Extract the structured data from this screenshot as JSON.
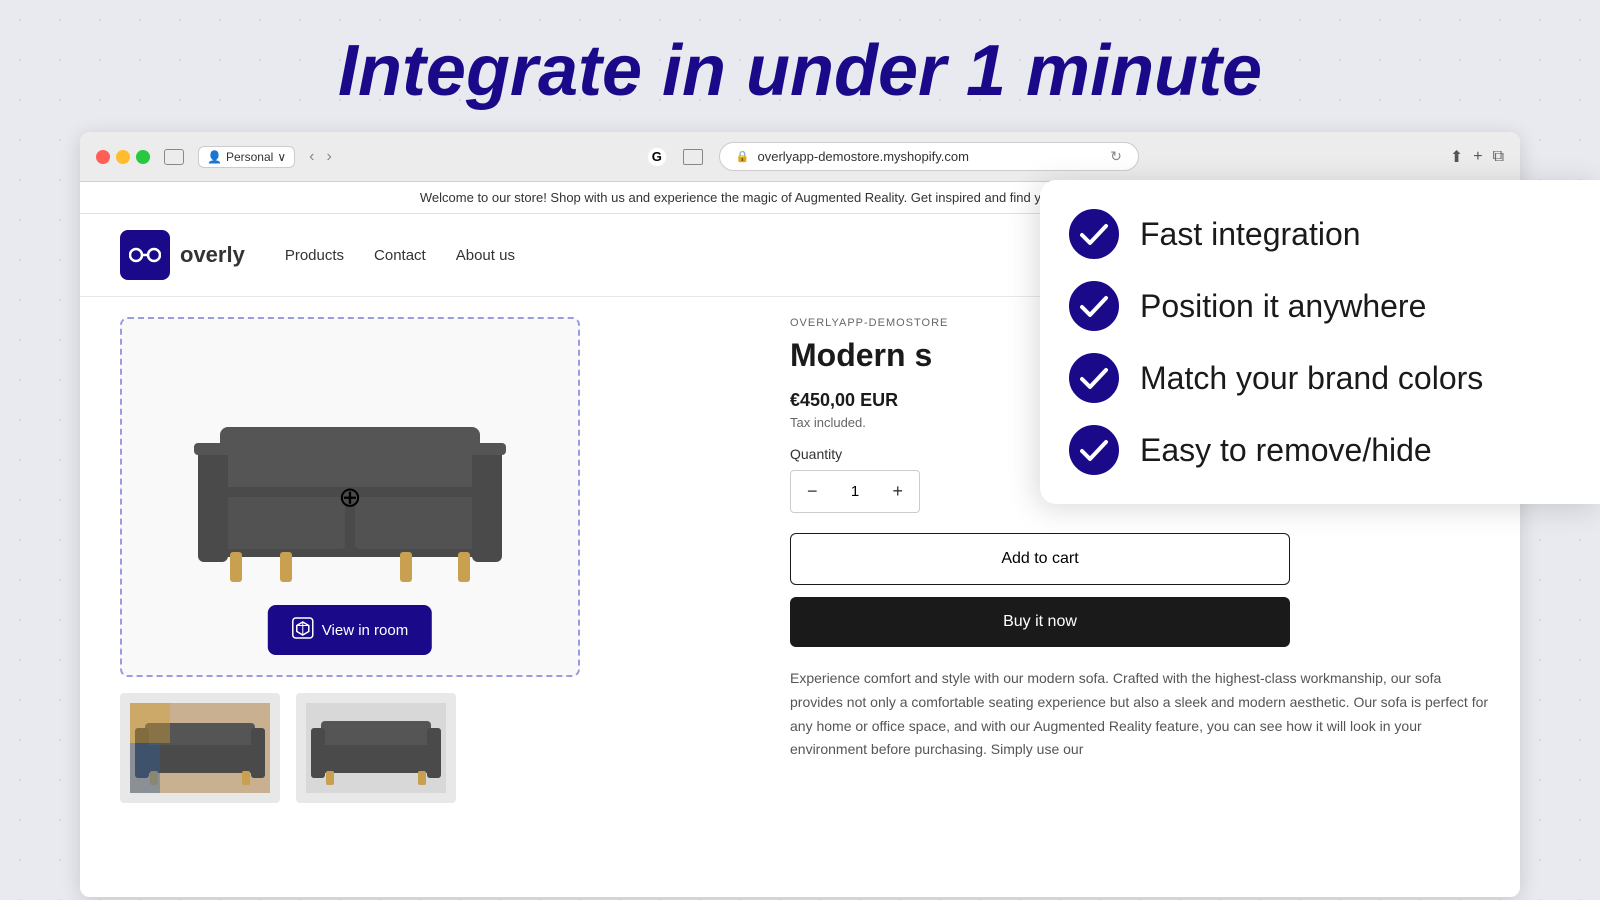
{
  "heading": {
    "title": "Integrate in under 1 minute"
  },
  "browser": {
    "profile": "Personal",
    "url": "overlyapp-demostore.myshopify.com",
    "favicon": "G"
  },
  "store": {
    "announcement": "Welcome to our store! Shop with us and experience the magic of Augmented Reality. Get inspired and find your perfect match today.",
    "logo_text": "overly",
    "nav": [
      "Products",
      "Contact",
      "About us"
    ],
    "store_label": "OVERLYAPP-DEMOSTORE",
    "product_title": "Modern s",
    "price": "€450,00 EUR",
    "tax_note": "Tax included.",
    "quantity_label": "Quantity",
    "quantity_value": "1",
    "add_to_cart": "Add to cart",
    "buy_now": "Buy it now",
    "description": "Experience comfort and style with our modern sofa. Crafted with the highest-class workmanship, our sofa provides not only a comfortable seating experience but also a sleek and modern aesthetic. Our sofa is perfect for any home or office space, and with our Augmented Reality feature, you can see how it will look in your environment before purchasing. Simply use our",
    "view_in_room": "View in room"
  },
  "features": [
    {
      "icon": "check-circle",
      "text": "Fast integration"
    },
    {
      "icon": "check-circle",
      "text": "Position it anywhere"
    },
    {
      "icon": "check-circle",
      "text": "Match your brand colors"
    },
    {
      "icon": "check-circle",
      "text": "Easy to remove/hide"
    }
  ]
}
